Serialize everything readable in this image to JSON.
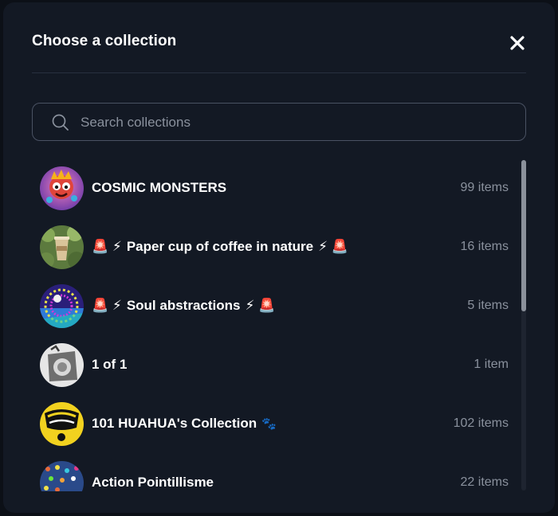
{
  "modal": {
    "title": "Choose a collection",
    "close_icon": "close-icon"
  },
  "search": {
    "placeholder": "Search collections",
    "value": "",
    "icon": "search-icon"
  },
  "collections": [
    {
      "name": "COSMIC MONSTERS",
      "count": "99 items"
    },
    {
      "name": "Paper cup of coffee in nature",
      "prefix": "🚨 ⚡",
      "suffix": "⚡ 🚨",
      "count": "16 items"
    },
    {
      "name": "Soul abstractions",
      "prefix": "🚨 ⚡",
      "suffix": "⚡ 🚨",
      "count": "5 items"
    },
    {
      "name": "1 of 1",
      "count": "1 item"
    },
    {
      "name": "101 HUAHUA's Collection",
      "suffix": "🐾",
      "count": "102 items"
    },
    {
      "name": "Action Pointillisme",
      "count": "22 items"
    }
  ],
  "colors": {
    "background": "#0c1017",
    "modal": "#131924",
    "muted_text": "#8a919d",
    "border": "#4a5263"
  }
}
